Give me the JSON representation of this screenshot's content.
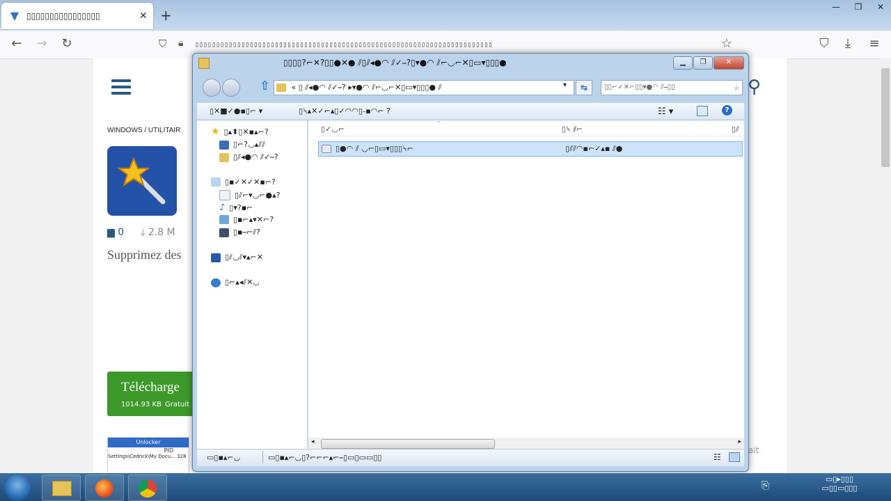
{
  "browser": {
    "tab_title": "▯▯▯▯▯▯▯▯▯▯▯▯▯▯▯▯",
    "tab_close": "✕",
    "new_tab": "+",
    "url": "▯▯▯▯▯▯▯▯▯▯▯▯▯▯▯▯▯▯▯▯▯▯▯▯▯▯▯▯▯▯▯▯▯▯▯▯▯▯▯▯▯▯▯▯▯▯▯▯▯▯▯▯▯▯▯▯▯▯▯▯▯▯▯▯▯▯▯▯▯▯▯",
    "window_buttons": [
      "—",
      "❐",
      "✕"
    ]
  },
  "page": {
    "breadcrumb": "WINDOWS  /  UTILITAIR",
    "comments_count": "0",
    "downloads": "2.8 M",
    "description": "Supprimez des",
    "download_button": {
      "label": "Télécharge",
      "size": "1014.93 KB",
      "price": "Gratuit"
    },
    "thumb_title": "Unlocker",
    "thumb_col": "PID",
    "thumb_path": "Settings\\Cedrick\\My Docu...",
    "thumb_value": "328",
    "right_fragment": "rait"
  },
  "explorer": {
    "title": "▯▯▯▯?⌐✕?▯▯●✕● ⫽▯⫽◂●◠ ⫽✓⎯?▯▾●◠ ⫽⌐◡⌐✕▯▭▾▯▯▯●",
    "address": "« ▯ ⫽◂●◠ ⫽✓⎯?  ▸▾●◠ ⫽⌐◡⌐✕▯▭▾▯▯▯● ⫽",
    "search_placeholder": "▯▯⌐✓✕⌐▯▯▾●◠ ⫽⎯▯▯",
    "toolbar": {
      "organize": "▯✕■✓●▪▯⌐ ▾",
      "burn": "▯⍀▴✕✓⌐▴▯✓◠◠▯⎯▪◠⌐ ?"
    },
    "columns": {
      "name": "▯✓◡⌐",
      "date": "▯⍀ ⫽⌐",
      "type": "▯⫽"
    },
    "file_row": {
      "name": "▯●◠ ⫽ ◡⌐▯▭▾▯▯▯⍀⌐",
      "date": "▯⫽⫽◠▪⌐✓▴▪ ⫽●"
    },
    "nav": {
      "favorites": "▯▴⬍▯✕▪▴⌐?",
      "fav_items": [
        "▯⌐?◡▴⫽⫽",
        "▯⫽◂●◠ ⫽✓⎯?"
      ],
      "libraries": "▯▪✓✕✓✕▪⌐?",
      "lib_items": [
        "▯⫽⌐▾◡⌐●▴?",
        "▯▾?▪⌐",
        "▯▪⌐▴▾✕⌐?",
        "▯▪⎯⌐⫽?"
      ],
      "computer": "▯⫽◡⫽▾▴⌐✕",
      "network": "▯⌐▴◂⫽✕◡"
    },
    "status": {
      "left": "▭▯▪▴⌐◡",
      "right": "▭▯▪▴⌐◡▯?⌐⌐⌐▴⌐⎯▯▭▯▭▭▯▯"
    }
  },
  "taskbar": {
    "tray_line1": "▭▯▸▯▯▯",
    "tray_line2": "▭▯▯▭▯▯▯"
  }
}
